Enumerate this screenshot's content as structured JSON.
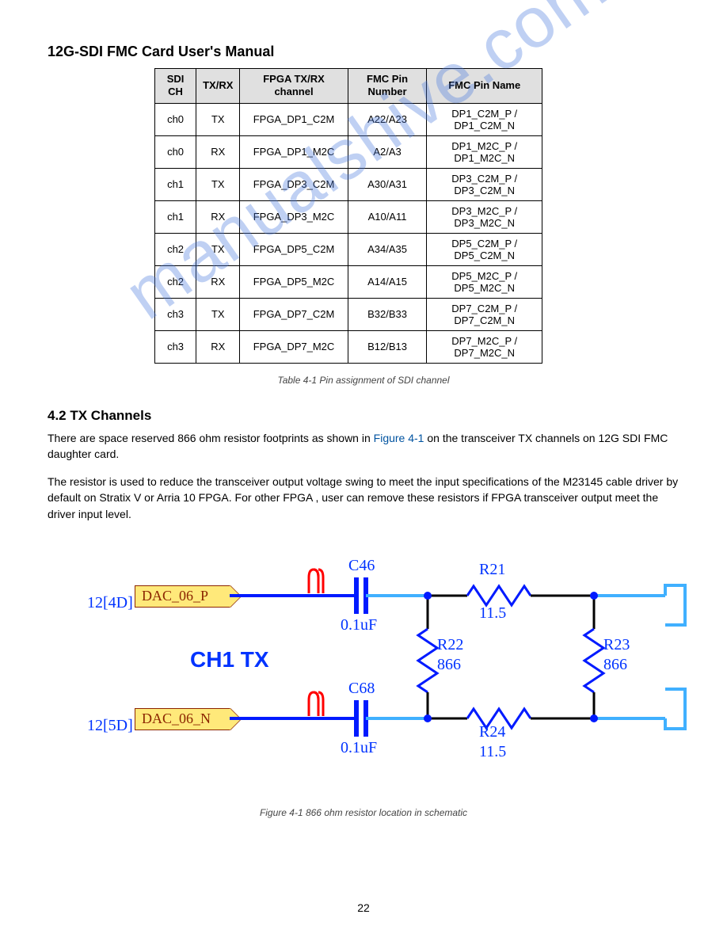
{
  "header": {
    "title": "12G-SDI FMC Card User's Manual"
  },
  "table": {
    "caption": "Table 4-1 Pin assignment of SDI channel",
    "columns": [
      "SDI CH",
      "TX/RX",
      "FPGA TX/RX channel",
      "FMC Pin Number",
      "FMC Pin Name"
    ],
    "rows": [
      [
        "ch0",
        "TX",
        "FPGA_DP1_C2M",
        "A22/A23",
        "DP1_C2M_P / DP1_C2M_N"
      ],
      [
        "ch0",
        "RX",
        "FPGA_DP1_M2C",
        "A2/A3",
        "DP1_M2C_P / DP1_M2C_N"
      ],
      [
        "ch1",
        "TX",
        "FPGA_DP3_C2M",
        "A30/A31",
        "DP3_C2M_P / DP3_C2M_N"
      ],
      [
        "ch1",
        "RX",
        "FPGA_DP3_M2C",
        "A10/A11",
        "DP3_M2C_P / DP3_M2C_N"
      ],
      [
        "ch2",
        "TX",
        "FPGA_DP5_C2M",
        "A34/A35",
        "DP5_C2M_P / DP5_C2M_N"
      ],
      [
        "ch2",
        "RX",
        "FPGA_DP5_M2C",
        "A14/A15",
        "DP5_M2C_P / DP5_M2C_N"
      ],
      [
        "ch3",
        "TX",
        "FPGA_DP7_C2M",
        "B32/B33",
        "DP7_C2M_P / DP7_C2M_N"
      ],
      [
        "ch3",
        "RX",
        "FPGA_DP7_M2C",
        "B12/B13",
        "DP7_M2C_P / DP7_M2C_N"
      ]
    ]
  },
  "section": {
    "heading": "4.2 TX Channels",
    "body_prefix": "There are space reserved 866 ohm resistor footprints as shown in ",
    "body_ref": "Figure 4-1",
    "body_suffix": " on the transceiver TX channels on 12G SDI FMC daughter card.",
    "body_paragraph2": "The resistor is used to reduce the transceiver output voltage swing to meet the input specifications of the M23145 cable driver by default on Stratix V or Arria 10 FPGA. For other FPGA , user can remove these resistors if FPGA transceiver output meet the driver input level."
  },
  "schematic": {
    "ch_label": "CH1 TX",
    "nets": {
      "p": {
        "sheetref": "12[4D]",
        "name": "DAC_06_P"
      },
      "n": {
        "sheetref": "12[5D]",
        "name": "DAC_06_N"
      }
    },
    "components": {
      "C46": {
        "ref": "C46",
        "value": "0.1uF"
      },
      "C68": {
        "ref": "C68",
        "value": "0.1uF"
      },
      "R21": {
        "ref": "R21",
        "value": "11.5"
      },
      "R22": {
        "ref": "R22",
        "value": "866"
      },
      "R23": {
        "ref": "R23",
        "value": "866"
      },
      "R24": {
        "ref": "R24",
        "value": "11.5"
      }
    },
    "caption": "Figure 4-1 866 ohm resistor location in schematic"
  },
  "footer": {
    "page": "22"
  },
  "watermark": "manualshive.com"
}
